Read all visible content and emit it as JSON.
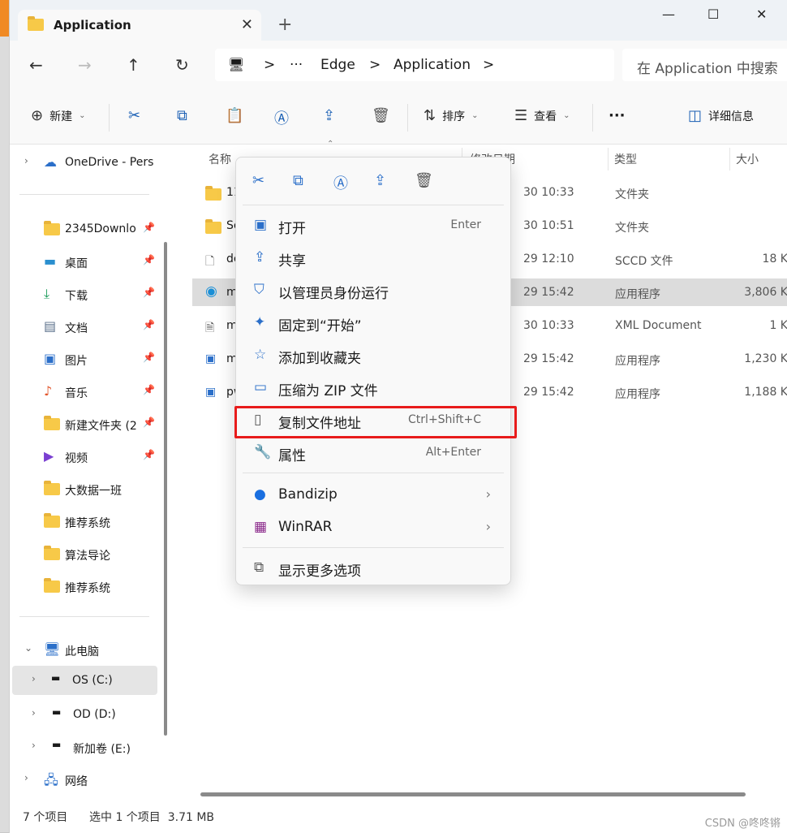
{
  "window": {
    "tab_title": "Application",
    "new_tab": "+",
    "minimize": "—",
    "maximize": "☐",
    "close": "✕"
  },
  "nav": {
    "back": "←",
    "forward": "→",
    "up": "↑",
    "refresh": "↻"
  },
  "address": {
    "separator": ">",
    "ellipsis": "···",
    "crumbs": [
      "Edge",
      "Application"
    ],
    "search_placeholder": "在 Application 中搜索"
  },
  "toolbar": {
    "new": "新建",
    "sort": "排序",
    "view": "查看",
    "more": "···",
    "details": "详细信息"
  },
  "sidebar": {
    "onedrive": "OneDrive - Pers",
    "quick": [
      {
        "label": "2345Downlo",
        "pinned": true
      },
      {
        "label": "桌面",
        "pinned": true
      },
      {
        "label": "下载",
        "pinned": true
      },
      {
        "label": "文档",
        "pinned": true
      },
      {
        "label": "图片",
        "pinned": true
      },
      {
        "label": "音乐",
        "pinned": true
      },
      {
        "label": "新建文件夹 (2",
        "pinned": true
      },
      {
        "label": "视频",
        "pinned": true
      },
      {
        "label": "大数据一班",
        "pinned": false
      },
      {
        "label": "推荐系统",
        "pinned": false
      },
      {
        "label": "算法导论",
        "pinned": false
      },
      {
        "label": "推荐系统",
        "pinned": false
      }
    ],
    "this_pc": "此电脑",
    "drives": [
      "OS (C:)",
      "OD (D:)",
      "新加卷 (E:)"
    ],
    "network": "网络"
  },
  "columns": {
    "name": "名称",
    "date": "修改日期",
    "type": "类型",
    "size": "大小"
  },
  "files": [
    {
      "name": "119",
      "date": "30 10:33",
      "type": "文件夹",
      "size": ""
    },
    {
      "name": "Set",
      "date": "30 10:51",
      "type": "文件夹",
      "size": ""
    },
    {
      "name": "del",
      "date": "29 12:10",
      "type": "SCCD 文件",
      "size": "18 K"
    },
    {
      "name": "ms",
      "date": "29 15:42",
      "type": "应用程序",
      "size": "3,806 K"
    },
    {
      "name": "ms",
      "date": "30 10:33",
      "type": "XML Document",
      "size": "1 K"
    },
    {
      "name": "ms",
      "date": "29 15:42",
      "type": "应用程序",
      "size": "1,230 K"
    },
    {
      "name": "pw",
      "date": "29 15:42",
      "type": "应用程序",
      "size": "1,188 K"
    }
  ],
  "context_menu": {
    "items": [
      {
        "label": "打开",
        "shortcut": "Enter"
      },
      {
        "label": "共享",
        "shortcut": ""
      },
      {
        "label": "以管理员身份运行",
        "shortcut": ""
      },
      {
        "label": "固定到“开始”",
        "shortcut": ""
      },
      {
        "label": "添加到收藏夹",
        "shortcut": ""
      },
      {
        "label": "压缩为 ZIP 文件",
        "shortcut": ""
      },
      {
        "label": "复制文件地址",
        "shortcut": "Ctrl+Shift+C"
      },
      {
        "label": "属性",
        "shortcut": "Alt+Enter"
      }
    ],
    "bandizip": "Bandizip",
    "winrar": "WinRAR",
    "more_options": "显示更多选项"
  },
  "status": {
    "count": "7 个项目",
    "selected": "选中 1 个项目  3.71 MB"
  },
  "watermark": "CSDN @咚咚锵",
  "colors": {
    "accent": "#2b6fc9",
    "highlight_border": "#e81b1b",
    "folder": "#f7c948"
  }
}
